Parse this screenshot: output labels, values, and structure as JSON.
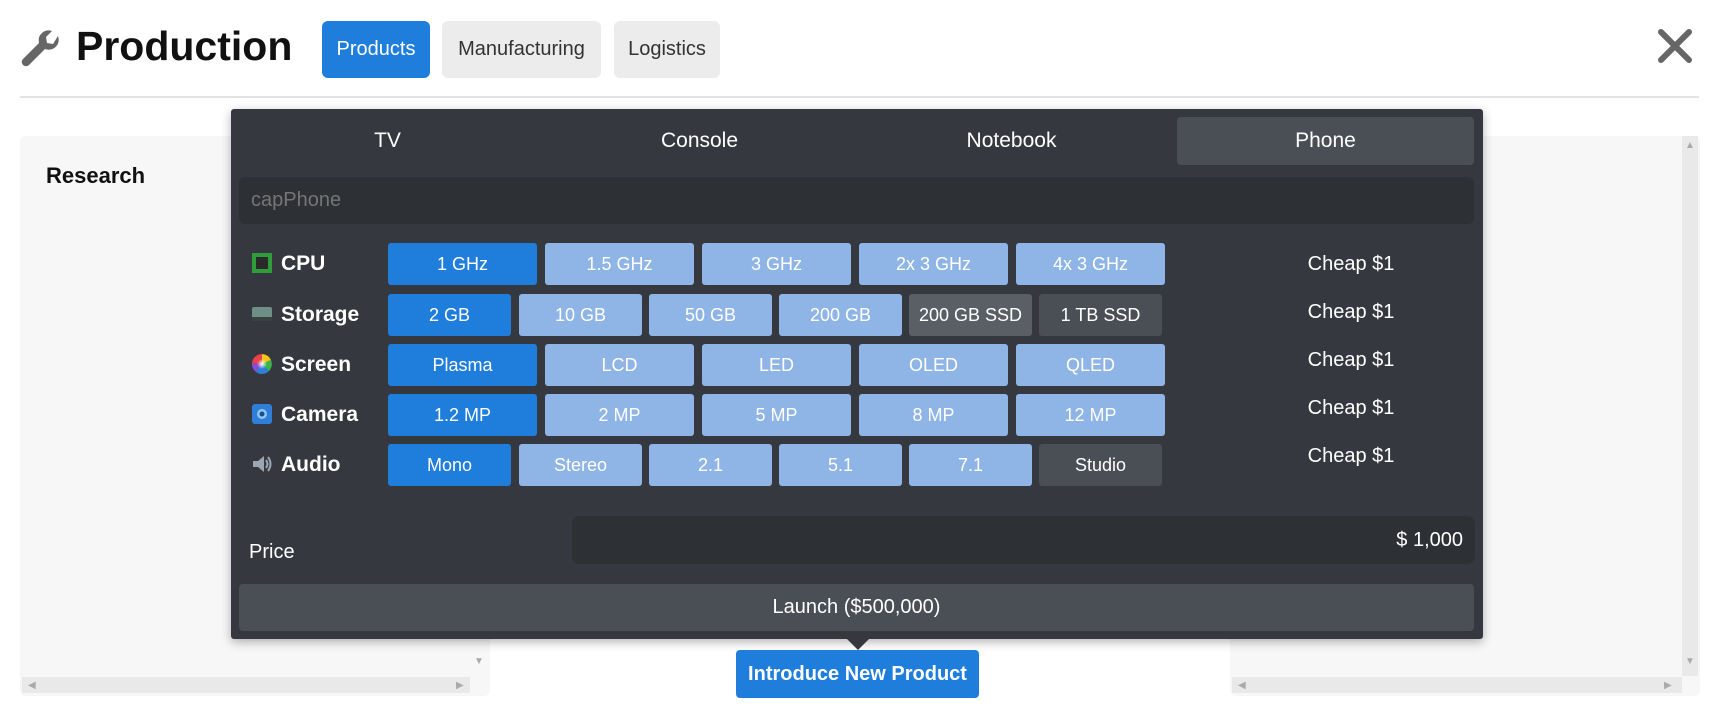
{
  "header": {
    "title": "Production",
    "tabs": [
      {
        "label": "Products",
        "active": true
      },
      {
        "label": "Manufacturing",
        "active": false
      },
      {
        "label": "Logistics",
        "active": false
      }
    ]
  },
  "research": {
    "title": "Research"
  },
  "popup": {
    "tabs": [
      {
        "label": "TV",
        "active": false
      },
      {
        "label": "Console",
        "active": false
      },
      {
        "label": "Notebook",
        "active": false
      },
      {
        "label": "Phone",
        "active": true
      }
    ],
    "name_placeholder": "capPhone",
    "rows": [
      {
        "label": "CPU",
        "icon": "cpu-chip-icon",
        "cost": "Cheap $1",
        "options": [
          {
            "label": "1 GHz",
            "state": "selected"
          },
          {
            "label": "1.5 GHz",
            "state": "available"
          },
          {
            "label": "3 GHz",
            "state": "available"
          },
          {
            "label": "2x 3 GHz",
            "state": "available"
          },
          {
            "label": "4x 3 GHz",
            "state": "available"
          }
        ]
      },
      {
        "label": "Storage",
        "icon": "hard-drive-icon",
        "cost": "Cheap $1",
        "options": [
          {
            "label": "2 GB",
            "state": "selected"
          },
          {
            "label": "10 GB",
            "state": "available"
          },
          {
            "label": "50 GB",
            "state": "available"
          },
          {
            "label": "200 GB",
            "state": "available"
          },
          {
            "label": "200 GB SSD",
            "state": "locked"
          },
          {
            "label": "1 TB SSD",
            "state": "locked"
          }
        ]
      },
      {
        "label": "Screen",
        "icon": "color-wheel-icon",
        "cost": "Cheap $1",
        "options": [
          {
            "label": "Plasma",
            "state": "selected"
          },
          {
            "label": "LCD",
            "state": "available"
          },
          {
            "label": "LED",
            "state": "available"
          },
          {
            "label": "OLED",
            "state": "available"
          },
          {
            "label": "QLED",
            "state": "available"
          }
        ]
      },
      {
        "label": "Camera",
        "icon": "camera-lens-icon",
        "cost": "Cheap $1",
        "options": [
          {
            "label": "1.2 MP",
            "state": "selected"
          },
          {
            "label": "2 MP",
            "state": "available"
          },
          {
            "label": "5 MP",
            "state": "available"
          },
          {
            "label": "8 MP",
            "state": "available"
          },
          {
            "label": "12 MP",
            "state": "available"
          }
        ]
      },
      {
        "label": "Audio",
        "icon": "speaker-icon",
        "cost": "Cheap $1",
        "options": [
          {
            "label": "Mono",
            "state": "selected"
          },
          {
            "label": "Stereo",
            "state": "available"
          },
          {
            "label": "2.1",
            "state": "available"
          },
          {
            "label": "5.1",
            "state": "available"
          },
          {
            "label": "7.1",
            "state": "available"
          },
          {
            "label": "Studio",
            "state": "locked"
          }
        ]
      }
    ],
    "price_label": "Price",
    "price_value": "$ 1,000",
    "launch_label": "Launch ($500,000)"
  },
  "intro_button": "Introduce New Product",
  "colors": {
    "accent": "#1f7ddb",
    "available": "#8fb4e6",
    "locked": "#4a4e55",
    "panel": "#35383e"
  }
}
